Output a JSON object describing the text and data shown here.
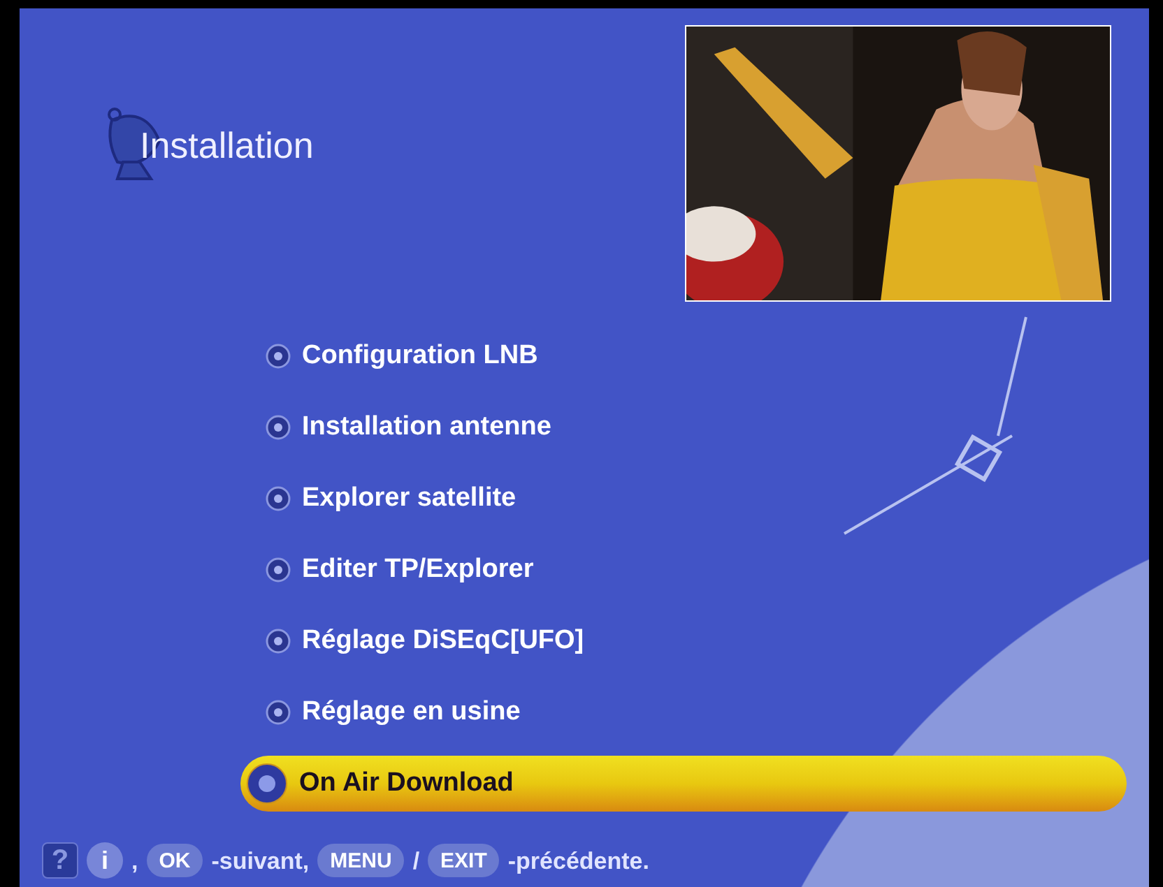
{
  "title": "Installation",
  "menu": [
    {
      "label": "Configuration LNB",
      "selected": false
    },
    {
      "label": "Installation antenne",
      "selected": false
    },
    {
      "label": "Explorer satellite",
      "selected": false
    },
    {
      "label": "Editer TP/Explorer",
      "selected": false
    },
    {
      "label": "Réglage DiSEqC[UFO]",
      "selected": false
    },
    {
      "label": "Réglage en usine",
      "selected": false
    },
    {
      "label": "On Air Download",
      "selected": true
    }
  ],
  "footer": [
    {
      "kind": "square-key",
      "label": "?"
    },
    {
      "kind": "round-key",
      "label": "i"
    },
    {
      "kind": "text",
      "label": ","
    },
    {
      "kind": "pill-key",
      "label": "OK"
    },
    {
      "kind": "text",
      "label": "-suivant,"
    },
    {
      "kind": "pill-key",
      "label": "MENU"
    },
    {
      "kind": "text",
      "label": "/"
    },
    {
      "kind": "pill-key",
      "label": "EXIT"
    },
    {
      "kind": "text",
      "label": "-précédente."
    }
  ]
}
